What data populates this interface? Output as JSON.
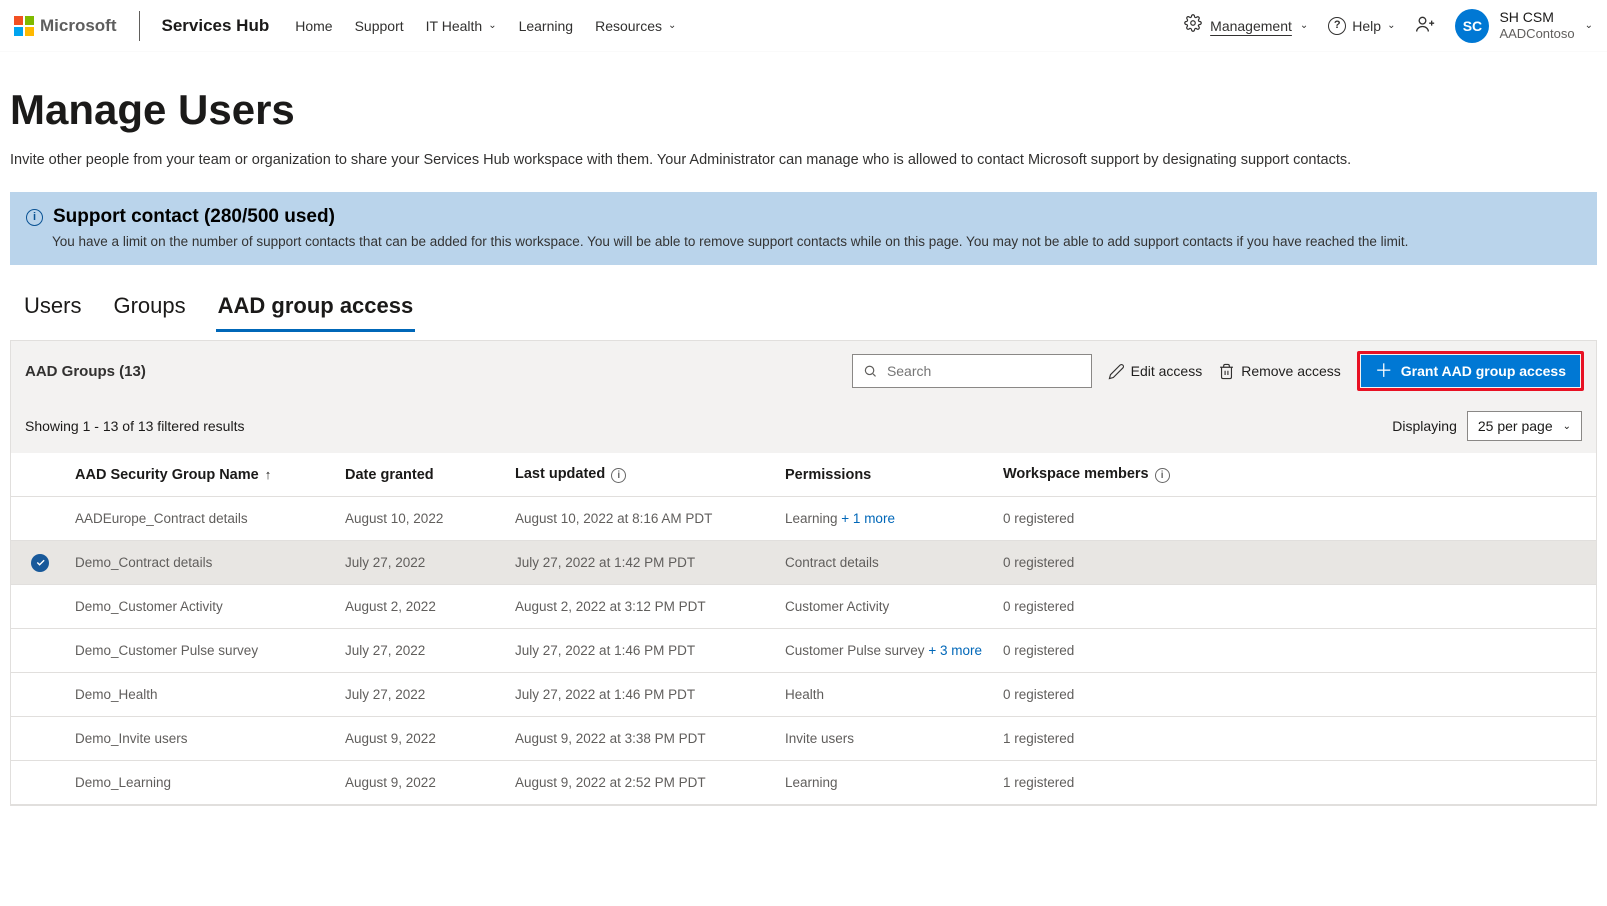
{
  "header": {
    "product": "Microsoft",
    "brand": "Services Hub",
    "nav": [
      {
        "label": "Home",
        "dropdown": false
      },
      {
        "label": "Support",
        "dropdown": false
      },
      {
        "label": "IT Health",
        "dropdown": true
      },
      {
        "label": "Learning",
        "dropdown": false
      },
      {
        "label": "Resources",
        "dropdown": true
      }
    ],
    "management_label": "Management",
    "help_label": "Help",
    "account": {
      "initials": "SC",
      "name": "SH CSM",
      "org": "AADContoso"
    }
  },
  "page": {
    "title": "Manage Users",
    "subtitle": "Invite other people from your team or organization to share your Services Hub workspace with them. Your Administrator can manage who is allowed to contact Microsoft support by designating support contacts."
  },
  "banner": {
    "title": "Support contact (280/500 used)",
    "body": "You have a limit on the number of support contacts that can be added for this workspace. You will be able to remove support contacts while on this page. You may not be able to add support contacts if you have reached the limit."
  },
  "tabs": [
    {
      "label": "Users",
      "active": false
    },
    {
      "label": "Groups",
      "active": false
    },
    {
      "label": "AAD group access",
      "active": true
    }
  ],
  "toolbar": {
    "heading": "AAD Groups (13)",
    "search_placeholder": "Search",
    "edit_label": "Edit access",
    "remove_label": "Remove access",
    "grant_label": "Grant AAD group access"
  },
  "results": {
    "summary": "Showing 1 - 13 of 13 filtered results",
    "display_label": "Displaying",
    "per_page": "25 per page"
  },
  "columns": {
    "name": "AAD Security Group Name",
    "date": "Date granted",
    "updated": "Last updated",
    "perm": "Permissions",
    "members": "Workspace members"
  },
  "rows": [
    {
      "selected": false,
      "name": "AADEurope_Contract details",
      "date": "August 10, 2022",
      "updated": "August 10, 2022 at 8:16 AM PDT",
      "perm": "Learning",
      "perm_more": "+ 1 more",
      "members": "0 registered"
    },
    {
      "selected": true,
      "name": "Demo_Contract details",
      "date": "July 27, 2022",
      "updated": "July 27, 2022 at 1:42 PM PDT",
      "perm": "Contract details",
      "perm_more": "",
      "members": "0 registered"
    },
    {
      "selected": false,
      "name": "Demo_Customer Activity",
      "date": "August 2, 2022",
      "updated": "August 2, 2022 at 3:12 PM PDT",
      "perm": "Customer Activity",
      "perm_more": "",
      "members": "0 registered"
    },
    {
      "selected": false,
      "name": "Demo_Customer Pulse survey",
      "date": "July 27, 2022",
      "updated": "July 27, 2022 at 1:46 PM PDT",
      "perm": "Customer Pulse survey",
      "perm_more": "+ 3 more",
      "members": "0 registered"
    },
    {
      "selected": false,
      "name": "Demo_Health",
      "date": "July 27, 2022",
      "updated": "July 27, 2022 at 1:46 PM PDT",
      "perm": "Health",
      "perm_more": "",
      "members": "0 registered"
    },
    {
      "selected": false,
      "name": "Demo_Invite users",
      "date": "August 9, 2022",
      "updated": "August 9, 2022 at 3:38 PM PDT",
      "perm": "Invite users",
      "perm_more": "",
      "members": "1 registered"
    },
    {
      "selected": false,
      "name": "Demo_Learning",
      "date": "August 9, 2022",
      "updated": "August 9, 2022 at 2:52 PM PDT",
      "perm": "Learning",
      "perm_more": "",
      "members": "1 registered"
    }
  ]
}
